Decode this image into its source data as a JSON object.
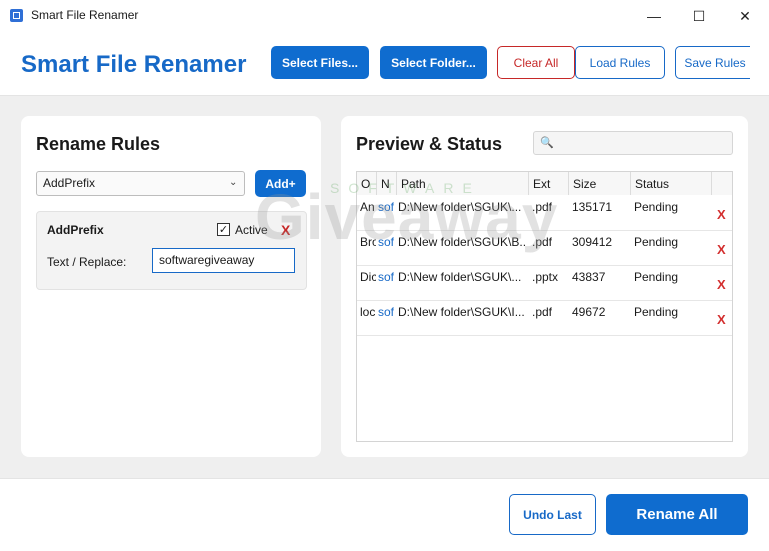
{
  "window": {
    "title": "Smart File Renamer",
    "minimize": "—",
    "maximize": "☐",
    "close": "✕"
  },
  "header": {
    "app_title": "Smart File Renamer",
    "buttons": {
      "select_files": "Select Files...",
      "select_folder": "Select Folder...",
      "clear_all": "Clear All",
      "load_rules": "Load Rules",
      "save_rules": "Save Rules"
    }
  },
  "rules_panel": {
    "title": "Rename Rules",
    "rule_type_selected": "AddPrefix",
    "add_button": "Add+",
    "rule": {
      "name": "AddPrefix",
      "active_label": "Active",
      "active_checked": true,
      "remove": "X",
      "text_label": "Text / Replace:",
      "text_value": "softwaregiveaway"
    }
  },
  "preview_panel": {
    "title": "Preview & Status",
    "search_icon": "🔍",
    "columns": [
      "O",
      "N",
      "Path",
      "Ext",
      "Size",
      "Status"
    ],
    "rows": [
      {
        "original": "An",
        "new": "sof",
        "path": "D:\\New folder\\SGUK\\...",
        "ext": ".pdf",
        "size": "135171",
        "status": "Pending",
        "remove": "X"
      },
      {
        "original": "Bro",
        "new": "sof",
        "path": "D:\\New folder\\SGUK\\B...",
        "ext": ".pdf",
        "size": "309412",
        "status": "Pending",
        "remove": "X"
      },
      {
        "original": "Dic",
        "new": "sof",
        "path": "D:\\New folder\\SGUK\\...",
        "ext": ".pptx",
        "size": "43837",
        "status": "Pending",
        "remove": "X"
      },
      {
        "original": "loc",
        "new": "sof",
        "path": "D:\\New folder\\SGUK\\I...",
        "ext": ".pdf",
        "size": "49672",
        "status": "Pending",
        "remove": "X"
      }
    ]
  },
  "footer": {
    "undo_last": "Undo Last",
    "rename_all": "Rename All"
  },
  "watermark": {
    "text": "Giveaway",
    "sub": "SOFTWARE"
  },
  "colors": {
    "accent": "#0f6ccf",
    "danger": "#c62828",
    "title": "#1769c7"
  }
}
